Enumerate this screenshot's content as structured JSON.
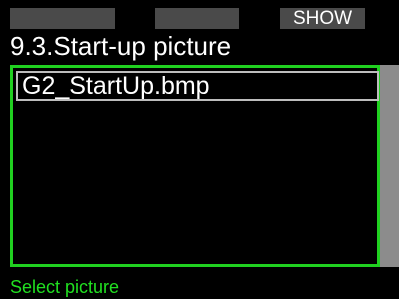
{
  "softkeys": {
    "left": "",
    "middle": "",
    "right": "SHOW"
  },
  "page": {
    "title": "9.3.Start-up picture"
  },
  "list": {
    "items": [
      {
        "label": "G2_StartUp.bmp",
        "selected": true
      }
    ]
  },
  "status": {
    "hint": "Select picture"
  },
  "colors": {
    "background": "#000000",
    "accent_green": "#20d020",
    "softkey_bg": "#4a4a4a",
    "selection_border": "#bdbdbd",
    "scrollbar": "#8c8c8c"
  }
}
